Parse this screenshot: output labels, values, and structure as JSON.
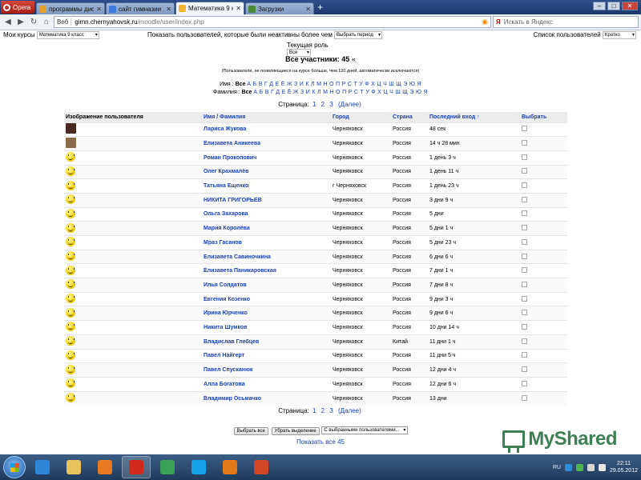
{
  "browser": {
    "menu_label": "Opera",
    "tabs": [
      {
        "label": "программы дист...",
        "color": "#e4a02c",
        "active": false
      },
      {
        "label": "сайт гимназии 2 ...",
        "color": "#3c7dd9",
        "active": false
      },
      {
        "label": "Математика 9 кла...",
        "color": "#f3b531",
        "active": true
      },
      {
        "label": "Загрузки",
        "color": "#4a8c3b",
        "active": false
      }
    ],
    "url_badge": "Веб",
    "url_host": "gimn.chernyahovsk.ru",
    "url_path": "/moodle/user/index.php",
    "search_placeholder": "Искать в Яндекс"
  },
  "controls": {
    "my_courses_label": "Мои курсы",
    "my_courses_value": "Математика 9 класс",
    "inactive_label": "Показать пользователей, которые были неактивны более чем",
    "inactive_value": "Выбрать период",
    "user_list_label": "Список пользователей",
    "user_list_value": "Кратко",
    "role_label": "Текущая роль",
    "role_value": "Все"
  },
  "summary": {
    "count_text": "Все участники: 45",
    "note": "(Пользователи, не появляющиеся на курсе больше, чем 120 дней, автоматически исключаются)"
  },
  "alpha_filter": {
    "first_label": "Имя :",
    "last_label": "Фамилия :",
    "all": "Все",
    "letters": "А Б В Г Д Е Ё Ж З И К Л М Н О П Р С Т У Ф Х Ц Ч Ш Щ Э Ю Я"
  },
  "pager": {
    "label": "Страница:",
    "pages": [
      "1",
      "2",
      "3"
    ],
    "next": "(Далее)"
  },
  "table": {
    "headers": {
      "avatar": "Изображение пользователя",
      "name": "Имя / Фамилия",
      "city": "Город",
      "country": "Страна",
      "last_access": "Последний вход ↑",
      "select": "Выбрать"
    },
    "rows": [
      {
        "avatar": "photo",
        "photo_color": "#4a2a22",
        "name": "Лариса Жукова",
        "city": "Черняховск",
        "country": "Россия",
        "last": "48 сек"
      },
      {
        "avatar": "photo",
        "photo_color": "#8a6a48",
        "name": "Елизавета Аникеева",
        "city": "Черняховск",
        "country": "Россия",
        "last": "14 ч 28 мин"
      },
      {
        "avatar": "smile",
        "name": "Роман Прокопович",
        "city": "Черняховск",
        "country": "Россия",
        "last": "1 день 3 ч"
      },
      {
        "avatar": "smile",
        "name": "Олег Крахмалёв",
        "city": "Черняховск",
        "country": "Россия",
        "last": "1 день 11 ч"
      },
      {
        "avatar": "smile",
        "name": "Татьяна Ещенко",
        "city": "г Черняховск",
        "country": "Россия",
        "last": "1 день 23 ч"
      },
      {
        "avatar": "smile",
        "name": "НИКИТА ГРИГОРЬЕВ",
        "city": "Черняховск",
        "country": "Россия",
        "last": "3 дни 9 ч"
      },
      {
        "avatar": "smile",
        "name": "Ольга Захарова",
        "city": "Черняховск",
        "country": "Россия",
        "last": "5 дни"
      },
      {
        "avatar": "smile",
        "name": "Мария Королёва",
        "city": "Черняховск",
        "country": "Россия",
        "last": "5 дни 1 ч"
      },
      {
        "avatar": "smile",
        "name": "Мраз Гасанов",
        "city": "Черняховск",
        "country": "Россия",
        "last": "5 дни 23 ч"
      },
      {
        "avatar": "smile",
        "name": "Елизавета Савиночкина",
        "city": "Черняховск",
        "country": "Россия",
        "last": "6 дни 6 ч"
      },
      {
        "avatar": "smile",
        "name": "Елизавета Паникаровская",
        "city": "Черняховск",
        "country": "Россия",
        "last": "7 дни 1 ч"
      },
      {
        "avatar": "smile",
        "name": "Илья Солдатов",
        "city": "Черняховск",
        "country": "Россия",
        "last": "7 дни 8 ч"
      },
      {
        "avatar": "smile",
        "name": "Евгения Козенко",
        "city": "Черняховск",
        "country": "Россия",
        "last": "9 дни 3 ч"
      },
      {
        "avatar": "smile",
        "name": "Ирина Юрченко",
        "city": "Черняховск",
        "country": "Россия",
        "last": "9 дни 6 ч"
      },
      {
        "avatar": "smile",
        "name": "Никита Шумков",
        "city": "Черняховск",
        "country": "Россия",
        "last": "10 дни 14 ч"
      },
      {
        "avatar": "smile",
        "name": "Владислав Глебцев",
        "city": "Черняховск",
        "country": "Китай",
        "last": "11 дни 1 ч"
      },
      {
        "avatar": "smile",
        "name": "Павел Найгерт",
        "city": "Черняховск",
        "country": "Россия",
        "last": "11 дни 5 ч"
      },
      {
        "avatar": "smile",
        "name": "Павел Спусканюк",
        "city": "Черняховск",
        "country": "Россия",
        "last": "12 дни 4 ч"
      },
      {
        "avatar": "smile",
        "name": "Алла Богатова",
        "city": "Черняховск",
        "country": "Россия",
        "last": "12 дни 6 ч"
      },
      {
        "avatar": "smile",
        "name": "Владимир Осьмачко",
        "city": "Черняховск",
        "country": "Россия",
        "last": "13 дни"
      }
    ]
  },
  "bottom": {
    "select_all": "Выбрать все",
    "deselect": "Убрать выделение",
    "with_selected": "С выбранными пользователями...",
    "show_all": "Показать все 45"
  },
  "watermark": "MyShared",
  "taskbar": {
    "apps": [
      {
        "name": "ie-icon",
        "color": "#2f86d8"
      },
      {
        "name": "explorer-icon",
        "color": "#e8c25a"
      },
      {
        "name": "media-player-icon",
        "color": "#ea7a1f"
      },
      {
        "name": "opera-icon",
        "color": "#d3281c",
        "active": true
      },
      {
        "name": "chrome-icon",
        "color": "#3aa357"
      },
      {
        "name": "skype-icon",
        "color": "#16a0e6"
      },
      {
        "name": "firefox-icon",
        "color": "#e07a1a"
      },
      {
        "name": "powerpoint-icon",
        "color": "#d24726"
      }
    ],
    "lang": "RU",
    "time": "22:11",
    "date": "29.05.2012"
  }
}
